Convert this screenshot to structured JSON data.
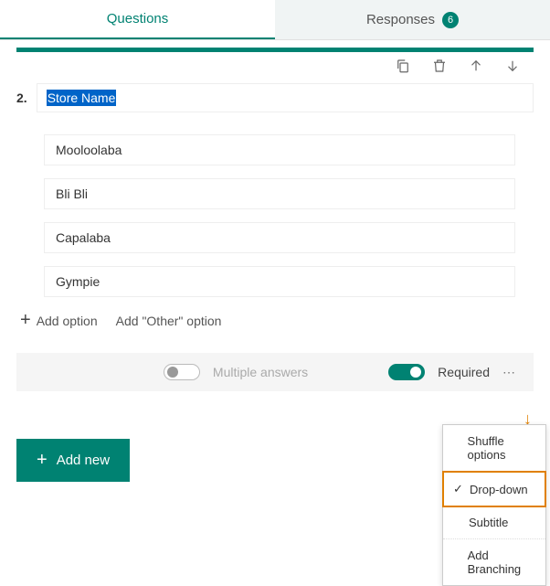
{
  "tabs": {
    "questions": "Questions",
    "responses": "Responses",
    "response_count": "6"
  },
  "question": {
    "number": "2.",
    "title": "Store Name",
    "options": [
      "Mooloolaba",
      "Bli Bli",
      "Capalaba",
      "Gympie"
    ],
    "add_option": "Add option",
    "add_other": "Add \"Other\" option"
  },
  "footer": {
    "multiple": "Multiple answers",
    "required": "Required"
  },
  "add_new": "Add new",
  "menu": {
    "shuffle": "Shuffle options",
    "dropdown": "Drop-down",
    "subtitle": "Subtitle",
    "branching": "Add Branching"
  }
}
